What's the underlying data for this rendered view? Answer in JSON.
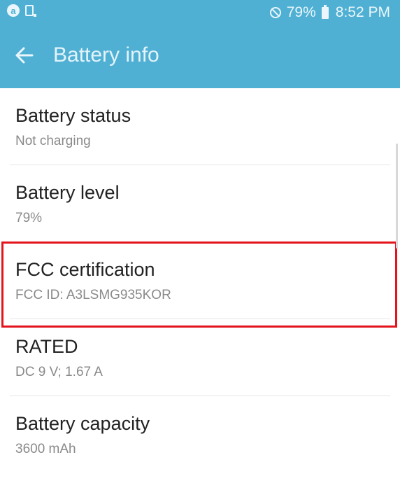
{
  "status_bar": {
    "battery_percent": "79%",
    "time": "8:52 PM",
    "icons": [
      "app-notification-icon",
      "screenshot-icon",
      "mute-icon",
      "battery-icon"
    ]
  },
  "app_bar": {
    "title": "Battery info",
    "back_icon": "back-arrow-icon"
  },
  "items": [
    {
      "title": "Battery status",
      "subtitle": "Not charging"
    },
    {
      "title": "Battery level",
      "subtitle": "79%"
    },
    {
      "title": "FCC certification",
      "subtitle": "FCC ID: A3LSMG935KOR"
    },
    {
      "title": "RATED",
      "subtitle": "DC 9 V; 1.67 A"
    },
    {
      "title": "Battery capacity",
      "subtitle": "3600 mAh"
    }
  ],
  "colors": {
    "app_bar": "#4fb0d4",
    "highlight": "#e3141c"
  }
}
